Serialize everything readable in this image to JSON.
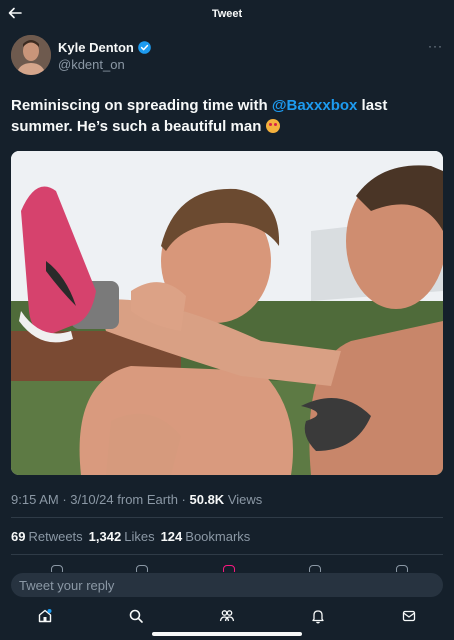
{
  "header": {
    "title": "Tweet",
    "back_icon": "back-arrow-icon"
  },
  "author": {
    "name": "Kyle Denton",
    "handle": "@kdent_on",
    "verified_icon": "verified-badge-icon",
    "more_icon": "more-icon",
    "more_label": "···"
  },
  "tweet": {
    "text_before": "Reminiscing on spreading time with ",
    "mention": "@Baxxxbox",
    "text_after": " last summer. He’s such a beautiful man ",
    "emoji_icon": "heart-eyes-emoji-icon",
    "media": "photo"
  },
  "meta": {
    "time": "9:15 AM",
    "sep1": " · ",
    "date": "3/10/24",
    "source": " from Earth",
    "sep2": " · ",
    "views_count": "50.8K",
    "views_label": " Views"
  },
  "stats": {
    "retweets_count": "69",
    "retweets_label": "Retweets",
    "likes_count": "1,342",
    "likes_label": "Likes",
    "bookmarks_count": "124",
    "bookmarks_label": "Bookmarks"
  },
  "reply": {
    "placeholder": "Tweet your reply"
  },
  "nav": {
    "items": [
      "home-icon",
      "search-icon",
      "communities-icon",
      "notifications-icon",
      "messages-icon"
    ]
  },
  "colors": {
    "accent": "#1d9bf0",
    "background": "#15202b",
    "muted": "#8b98a5"
  }
}
